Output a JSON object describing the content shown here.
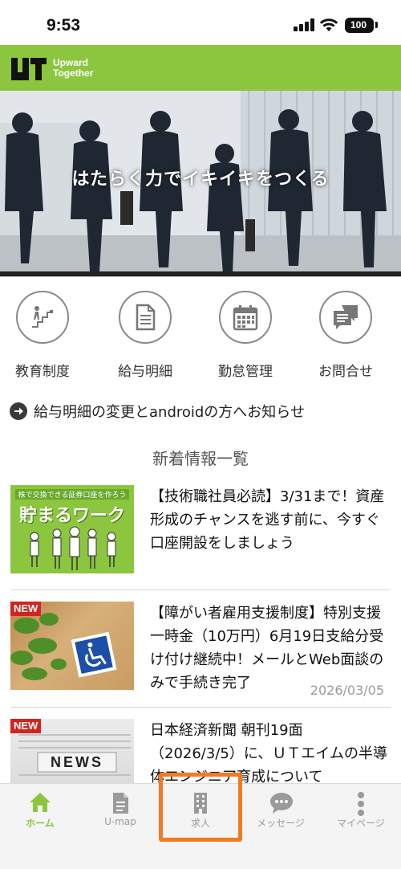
{
  "status_bar": {
    "time": "9:53",
    "battery": "100"
  },
  "header": {
    "logo_line1": "Upward",
    "logo_line2": "Together"
  },
  "hero": {
    "caption": "はたらく力でイキイキをつくる"
  },
  "quick_menu": [
    {
      "label": "教育制度",
      "icon": "stairs-climber-icon"
    },
    {
      "label": "給与明細",
      "icon": "document-icon"
    },
    {
      "label": "勤怠管理",
      "icon": "calendar-icon"
    },
    {
      "label": "お問合せ",
      "icon": "chat-bubbles-icon"
    }
  ],
  "notice": {
    "text": "給与明細の変更とandroidの方へお知らせ"
  },
  "section_title": "新着情報一覧",
  "news": [
    {
      "title": "【技術職社員必読】3/31まで！資産形成のチャンスを逃す前に、今すぐ口座開設をしましょう",
      "badge": "",
      "date": "",
      "thumb_top": "株で交換できる証券口座を作ろう",
      "thumb_main": "貯まるワーク"
    },
    {
      "title": "【障がい者雇用支援制度】特別支援一時金（10万円）6月19日支給分受け付け継続中！メールとWeb面談のみで手続き完了",
      "badge": "NEW",
      "date": "2026/03/05"
    },
    {
      "title": "日本経済新聞 朝刊19面（2026/3/5）に、ＵＴエイムの半導体エンジニア育成について",
      "badge": "NEW",
      "date": "",
      "thumb_main": "NEWS"
    }
  ],
  "bottom_nav": [
    {
      "label": "ホーム",
      "icon": "home-icon",
      "active": true
    },
    {
      "label": "U-map",
      "icon": "file-icon",
      "active": false
    },
    {
      "label": "求人",
      "icon": "building-icon",
      "active": false
    },
    {
      "label": "メッセージ",
      "icon": "message-icon",
      "active": false
    },
    {
      "label": "マイページ",
      "icon": "more-vertical-icon",
      "active": false
    }
  ],
  "colors": {
    "brand": "#8cc63f",
    "highlight": "#f47a20",
    "badge": "#d2231f"
  }
}
